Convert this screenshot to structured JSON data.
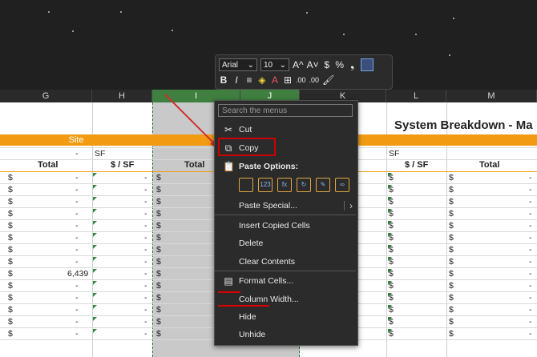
{
  "toolbar": {
    "font_name": "Arial",
    "font_size": "10",
    "grow_font_icon": "A^",
    "shrink_font_icon": "A˅",
    "currency_icon": "$",
    "percent_icon": "%",
    "comma_icon": "❟",
    "bold": "B",
    "italic": "I",
    "align_icon": "≡",
    "fill_icon": "◈",
    "font_color_icon": "A",
    "borders_icon": "⊞",
    "inc_decimal": ".00",
    "dec_decimal": ".00",
    "format_painter_icon": "🖌"
  },
  "columns": [
    "G",
    "H",
    "I",
    "J",
    "K",
    "L",
    "M"
  ],
  "sheet": {
    "title": "System Breakdown - Ma",
    "site_label": "Site",
    "dash_value": "-",
    "sf_label": "SF",
    "total_label": "Total",
    "per_sf_label": "$ / SF",
    "dollar": "$",
    "value_6439": "6,439"
  },
  "menu": {
    "search_placeholder": "Search the menus",
    "cut": "Cut",
    "copy": "Copy",
    "paste_options": "Paste Options:",
    "paste_special": "Paste Special...",
    "insert_copied": "Insert Copied Cells",
    "delete": "Delete",
    "clear_contents": "Clear Contents",
    "format_cells": "Format Cells...",
    "column_width": "Column Width...",
    "hide": "Hide",
    "unhide": "Unhide",
    "paste_icons": [
      "paste-icon",
      "paste-values-icon",
      "paste-formulas-icon",
      "paste-transpose-icon",
      "paste-formatting-icon",
      "paste-link-icon"
    ]
  },
  "colors": {
    "accent_orange": "#f29b12",
    "selected_column_green": "#3f7f3f",
    "highlight_red": "#cc0000",
    "dark_bg": "#202020"
  }
}
